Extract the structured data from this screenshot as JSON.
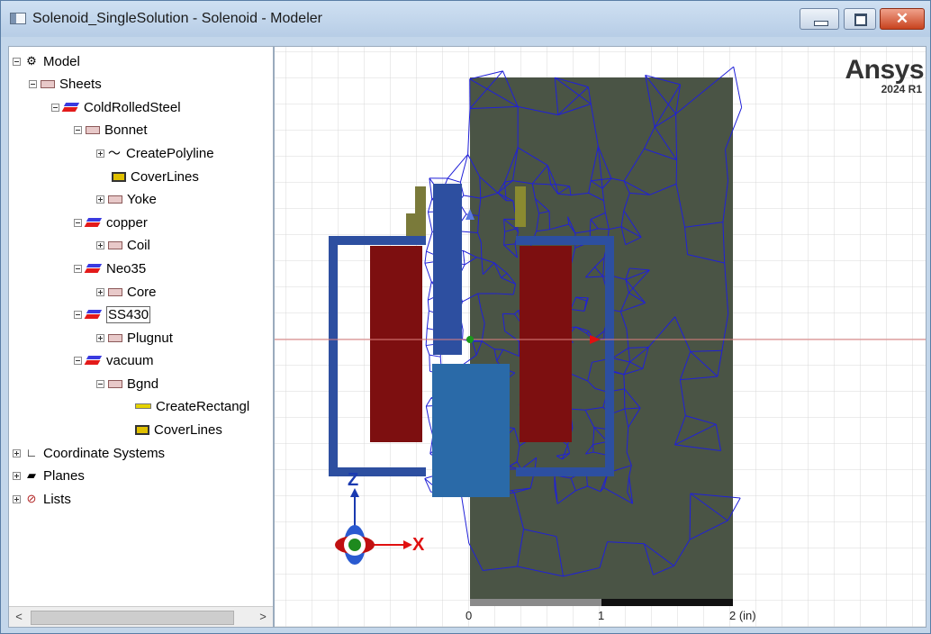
{
  "window": {
    "title": "Solenoid_SingleSolution - Solenoid - Modeler"
  },
  "tree": {
    "rows": [
      {
        "label": "Model"
      },
      {
        "label": "Sheets"
      },
      {
        "label": "ColdRolledSteel"
      },
      {
        "label": "Bonnet"
      },
      {
        "label": "CreatePolyline"
      },
      {
        "label": "CoverLines"
      },
      {
        "label": "Yoke"
      },
      {
        "label": "copper"
      },
      {
        "label": "Coil"
      },
      {
        "label": "Neo35"
      },
      {
        "label": "Core"
      },
      {
        "label": "SS430"
      },
      {
        "label": "Plugnut"
      },
      {
        "label": "vacuum"
      },
      {
        "label": "Bgnd"
      },
      {
        "label": "CreateRectangl"
      },
      {
        "label": "CoverLines"
      },
      {
        "label": "Coordinate Systems"
      },
      {
        "label": "Planes"
      },
      {
        "label": "Lists"
      }
    ],
    "scroll_left_icon": "<",
    "scroll_right_icon": ">"
  },
  "viewport": {
    "logo": {
      "name": "Ansys",
      "version": "2024 R1"
    },
    "axis_x_label": "X",
    "axis_z_label": "Z",
    "scale": {
      "tick0": "0",
      "tick1": "1",
      "tick2": "2 (in)"
    },
    "colors": {
      "mesh": "#2020d8",
      "background_region": "#4a5445",
      "coil": "#7d0f10",
      "steel_parts": "#2d4fa0",
      "grid": "#d9d9d9"
    }
  }
}
